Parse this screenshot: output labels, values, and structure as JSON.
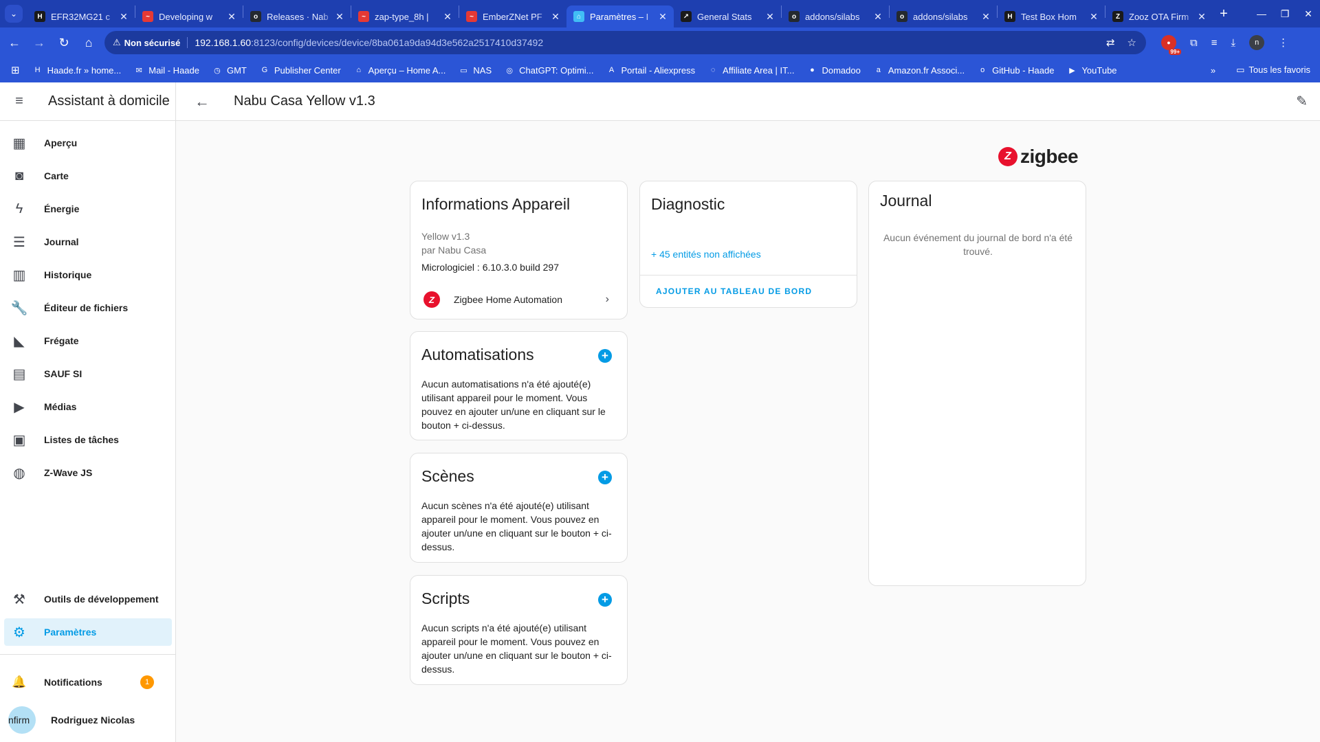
{
  "browser": {
    "tabs": [
      {
        "title": "EFR32MG21 c",
        "favicon": "H",
        "fav_color": "#1a1a1a"
      },
      {
        "title": "Developing w",
        "favicon": "~",
        "fav_color": "#e53935"
      },
      {
        "title": "Releases · Nab",
        "favicon": "o",
        "fav_color": "#24292f"
      },
      {
        "title": "zap-type_8h |",
        "favicon": "~",
        "fav_color": "#e53935"
      },
      {
        "title": "EmberZNet PF",
        "favicon": "~",
        "fav_color": "#e53935"
      },
      {
        "title": "Paramètres – I",
        "favicon": "⌂",
        "fav_color": "#41bdf5"
      },
      {
        "title": "General Stats",
        "favicon": "↗",
        "fav_color": "#1a1a1a"
      },
      {
        "title": "addons/silabs",
        "favicon": "o",
        "fav_color": "#24292f"
      },
      {
        "title": "addons/silabs",
        "favicon": "o",
        "fav_color": "#24292f"
      },
      {
        "title": "Test Box Hom",
        "favicon": "H",
        "fav_color": "#1a1a1a"
      },
      {
        "title": "Zooz OTA Firm",
        "favicon": "Z",
        "fav_color": "#1a1a1a"
      }
    ],
    "active_tab_index": 5,
    "security_label": "Non sécurisé",
    "url_host": "192.168.1.60",
    "url_path": ":8123/config/devices/device/8ba061a9da94d3e562a2517410d37492",
    "extension_badge": "99+",
    "profile_initial": "n",
    "bookmarks": [
      {
        "label": "Haade.fr » home...",
        "icon": "H"
      },
      {
        "label": "Mail - Haade",
        "icon": "✉"
      },
      {
        "label": "GMT",
        "icon": "◷"
      },
      {
        "label": "Publisher Center",
        "icon": "G"
      },
      {
        "label": "Aperçu – Home A...",
        "icon": "⌂"
      },
      {
        "label": "NAS",
        "icon": "▭"
      },
      {
        "label": "ChatGPT: Optimi...",
        "icon": "◎"
      },
      {
        "label": "Portail - Aliexpress",
        "icon": "A"
      },
      {
        "label": "Affiliate Area | IT...",
        "icon": "◌"
      },
      {
        "label": "Domadoo",
        "icon": "●"
      },
      {
        "label": "Amazon.fr Associ...",
        "icon": "a"
      },
      {
        "label": "GitHub - Haade",
        "icon": "o"
      },
      {
        "label": "YouTube",
        "icon": "▶"
      }
    ],
    "bookmarks_more": "»",
    "all_bookmarks": "Tous les favoris"
  },
  "sidebar": {
    "title": "Assistant à domicile",
    "items": [
      {
        "label": "Aperçu",
        "icon": "dashboard-icon",
        "glyph": "▦"
      },
      {
        "label": "Carte",
        "icon": "map-icon",
        "glyph": "◙"
      },
      {
        "label": "Énergie",
        "icon": "lightning-icon",
        "glyph": "ϟ"
      },
      {
        "label": "Journal",
        "icon": "list-icon",
        "glyph": "☰"
      },
      {
        "label": "Historique",
        "icon": "chart-icon",
        "glyph": "▥"
      },
      {
        "label": "Éditeur de fichiers",
        "icon": "wrench-icon",
        "glyph": "🔧"
      },
      {
        "label": "Frégate",
        "icon": "cctv-icon",
        "glyph": "◣"
      },
      {
        "label": "SAUF SI",
        "icon": "store-icon",
        "glyph": "▤"
      },
      {
        "label": "Médias",
        "icon": "media-icon",
        "glyph": "▶"
      },
      {
        "label": "Listes de tâches",
        "icon": "clipboard-icon",
        "glyph": "▣"
      },
      {
        "label": "Z-Wave JS",
        "icon": "zwave-icon",
        "glyph": "◍"
      }
    ],
    "dev_tools": {
      "label": "Outils de développement",
      "glyph": "⚒"
    },
    "settings": {
      "label": "Paramètres",
      "glyph": "⚙"
    },
    "notifications": {
      "label": "Notifications",
      "count": "1",
      "glyph": "🔔"
    },
    "user": {
      "label": "Rodriguez Nicolas",
      "avatar_text": "nfirm"
    }
  },
  "page": {
    "title": "Nabu Casa Yellow v1.3",
    "logo_text": "zigbee",
    "device_info": {
      "title": "Informations Appareil",
      "model": "Yellow v1.3",
      "manufacturer": "par Nabu Casa",
      "firmware": "Micrologiciel : 6.10.3.0 build 297",
      "integration": "Zigbee Home Automation"
    },
    "automations": {
      "title": "Automatisations",
      "text": "Aucun automatisations n'a été ajouté(e) utilisant appareil pour le moment. Vous pouvez en ajouter un/une en cliquant sur le bouton + ci-dessus."
    },
    "scenes": {
      "title": "Scènes",
      "text": "Aucun scènes n'a été ajouté(e) utilisant appareil pour le moment. Vous pouvez en ajouter un/une en cliquant sur le bouton + ci-dessus."
    },
    "scripts": {
      "title": "Scripts",
      "text": "Aucun scripts n'a été ajouté(e) utilisant appareil pour le moment. Vous pouvez en ajouter un/une en cliquant sur le bouton + ci-dessus."
    },
    "diagnostic": {
      "title": "Diagnostic",
      "hidden_entities": "+ 45 entités non affichées",
      "add_to_dashboard": "AJOUTER AU TABLEAU DE BORD"
    },
    "logbook": {
      "title": "Journal",
      "empty": "Aucun événement du journal de bord n'a été trouvé."
    }
  },
  "colors": {
    "accent": "#039be5",
    "chrome": "#2b55d6",
    "badge": "#ff9800",
    "zigbee": "#e8112d"
  }
}
